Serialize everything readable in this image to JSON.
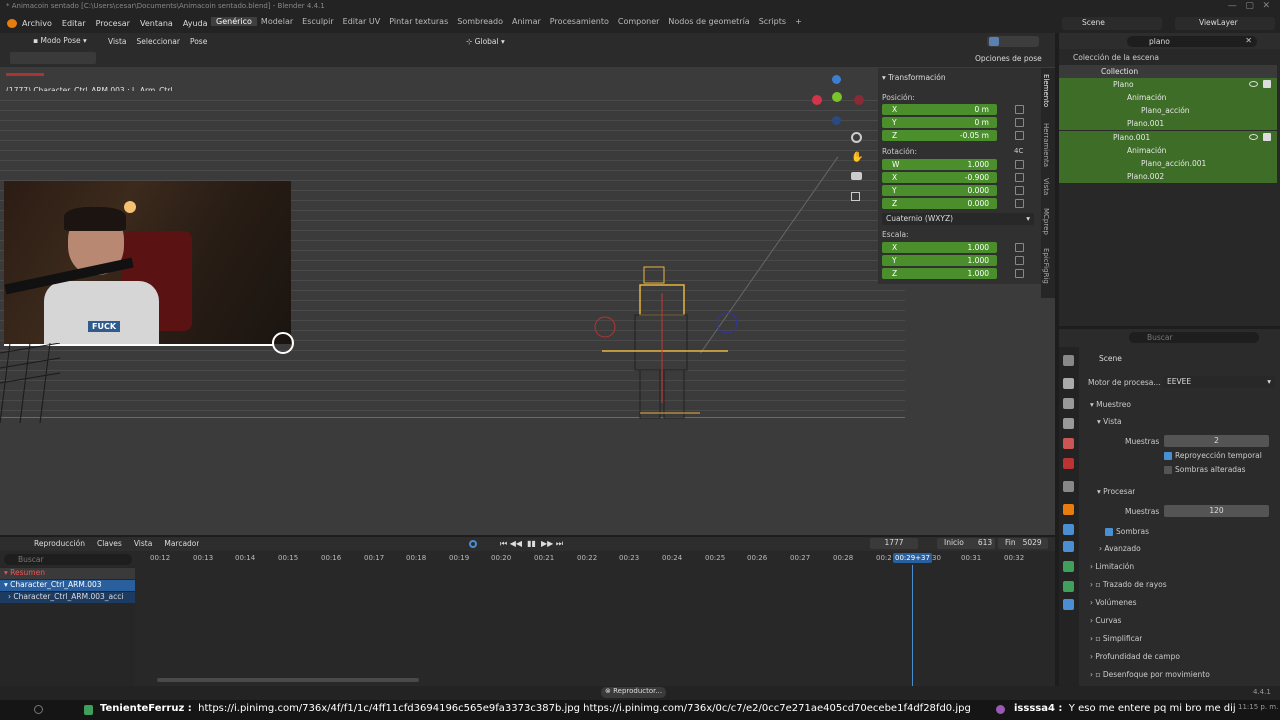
{
  "window": {
    "title": "* Animacoin sentado [C:\\Users\\cesar\\Documents\\Animacoin sentado.blend] - Blender 4.4.1"
  },
  "menu": [
    "Archivo",
    "Editar",
    "Procesar",
    "Ventana",
    "Ayuda"
  ],
  "workspaces": [
    "Genérico",
    "Modelar",
    "Esculpir",
    "Editar UV",
    "Pintar texturas",
    "Sombreado",
    "Animar",
    "Procesamiento",
    "Componer",
    "Nodos de geometría",
    "Scripts"
  ],
  "scene": {
    "name": "Scene",
    "view_layer": "ViewLayer"
  },
  "viewport": {
    "mode": "Modo Pose",
    "menu": [
      "Vista",
      "Seleccionar",
      "Pose"
    ],
    "orientation": "Global",
    "info": "(1777) Character_Ctrl_ARM.003 : L_Arm_Ctrl",
    "options": "Opciones de pose"
  },
  "npanel": {
    "header": "Transformación",
    "position_label": "Posición:",
    "position": [
      {
        "l": "X",
        "v": "0 m"
      },
      {
        "l": "Y",
        "v": "0 m"
      },
      {
        "l": "Z",
        "v": "-0.05 m"
      }
    ],
    "rotation_label": "Rotación:",
    "rot_mode_tag": "4C",
    "rotation": [
      {
        "l": "W",
        "v": "1.000"
      },
      {
        "l": "X",
        "v": "-0.900"
      },
      {
        "l": "Y",
        "v": "0.000"
      },
      {
        "l": "Z",
        "v": "0.000"
      }
    ],
    "rotation_mode": "Cuaternio (WXYZ)",
    "scale_label": "Escala:",
    "scale": [
      {
        "l": "X",
        "v": "1.000"
      },
      {
        "l": "Y",
        "v": "1.000"
      },
      {
        "l": "Z",
        "v": "1.000"
      }
    ],
    "tabs": [
      "Elemento",
      "Herramienta",
      "Vista",
      "MCprep",
      "EpicFigRig"
    ]
  },
  "outliner": {
    "search": "plano",
    "root": "Colección de la escena",
    "items": [
      "Collection",
      "Plano",
      "Animación",
      "Plano_acción",
      "Plano.001",
      "Plano.001",
      "Animación",
      "Plano_acción.001",
      "Plano.002"
    ]
  },
  "properties": {
    "search_placeholder": "Buscar",
    "context": "Scene",
    "engine_label": "Motor de procesa...",
    "engine": "EEVEE",
    "muestreo": "Muestreo",
    "vista": "Vista",
    "muestras_label": "Muestras",
    "muestras_vista": "2",
    "reproy": "Reproyección temporal",
    "sombras_alt": "Sombras alteradas",
    "procesar": "Procesar",
    "muestras_proc": "120",
    "sombras": "Sombras",
    "avanzado": "Avanzado",
    "sections": [
      "Limitación",
      "Trazado de rayos",
      "Volúmenes",
      "Curvas",
      "Simplificar",
      "Profundidad de campo",
      "Desenfoque por movimiento"
    ]
  },
  "timeline": {
    "menu": [
      "Reproducción",
      "Claves",
      "Vista",
      "Marcador"
    ],
    "frame": "1777",
    "start_label": "Inicio",
    "start": "613",
    "end_label": "Fin",
    "end": "5029",
    "search_placeholder": "Buscar",
    "ticks": [
      "00:12",
      "00:13",
      "00:14",
      "00:15",
      "00:16",
      "00:17",
      "00:18",
      "00:19",
      "00:20",
      "00:21",
      "00:22",
      "00:23",
      "00:24",
      "00:25",
      "00:26",
      "00:27",
      "00:28",
      "00:2",
      "00:31",
      "00:32"
    ],
    "current_time": "00:29+37",
    "tick_30": "30",
    "channels": [
      "Resumen",
      "Character_Ctrl_ARM.003",
      "Character_Ctrl_ARM.003_acci"
    ]
  },
  "statusbar": {
    "popup": "Reproductor...",
    "version": "4.4.1"
  },
  "chat": {
    "user1": "TenienteFerruz :",
    "msg1": "https://i.pinimg.com/736x/4f/f1/1c/4ff11cfd3694196c565e9fa3373c387b.jpg  https://i.pinimg.com/736x/0c/c7/e2/0cc7e271ae405cd70ecebe1f4df28fd0.jpg",
    "user2": "issssa4 :",
    "msg2": "Y eso me entere pq mi bro me dijo ajsj",
    "time": "11:15 p. m."
  },
  "webcam": {
    "shirt_text": "FUCK"
  },
  "colors": {
    "green_field": "#4a8f2c",
    "selected_blue": "#2a5f9e",
    "accent_orange": "#e8b441",
    "outliner_green": "#3d6d27"
  }
}
